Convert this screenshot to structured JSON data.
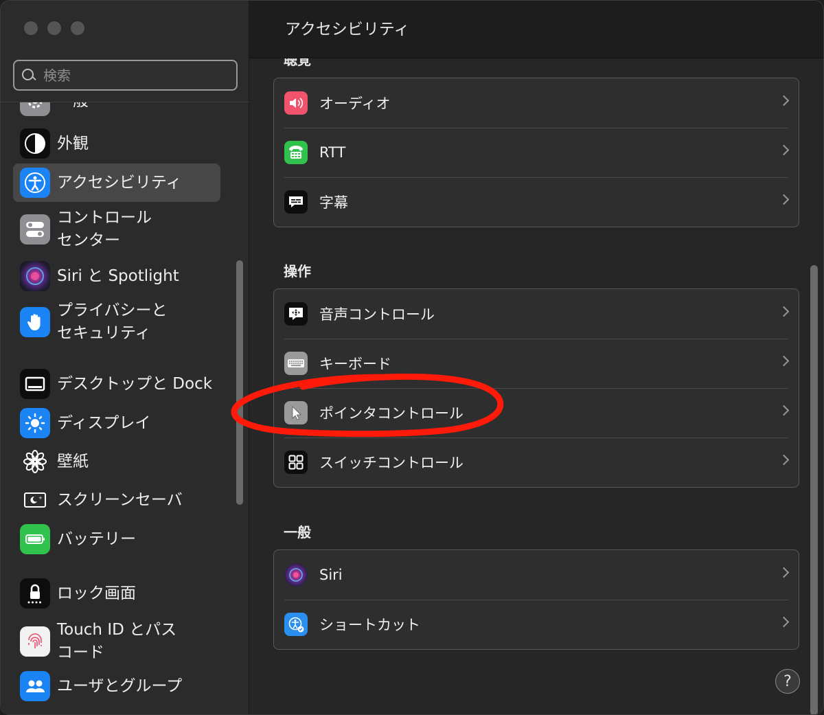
{
  "window": {
    "title": "アクセシビリティ"
  },
  "search": {
    "placeholder": "検索"
  },
  "sidebar": {
    "items": [
      {
        "label": "一般",
        "icon": "gear-icon"
      },
      {
        "label": "外観",
        "icon": "appearance-icon"
      },
      {
        "label": "アクセシビリティ",
        "icon": "accessibility-icon",
        "selected": true
      },
      {
        "label": "コントロール\nセンター",
        "icon": "control-center-icon"
      },
      {
        "label": "Siri と Spotlight",
        "icon": "siri-icon"
      },
      {
        "label": "プライバシーと\nセキュリティ",
        "icon": "hand-icon"
      },
      {
        "label": "デスクトップと Dock",
        "icon": "dock-icon"
      },
      {
        "label": "ディスプレイ",
        "icon": "sun-icon"
      },
      {
        "label": "壁紙",
        "icon": "flower-icon"
      },
      {
        "label": "スクリーンセーバ",
        "icon": "screensaver-icon"
      },
      {
        "label": "バッテリー",
        "icon": "battery-icon"
      },
      {
        "label": "ロック画面",
        "icon": "lock-icon"
      },
      {
        "label": "Touch ID とパス\nコード",
        "icon": "fingerprint-icon"
      },
      {
        "label": "ユーザとグループ",
        "icon": "users-icon"
      }
    ]
  },
  "main": {
    "cut_heading": "聴覚",
    "groups": [
      {
        "heading": "",
        "rows": [
          {
            "label": "オーディオ",
            "icon": "speaker-icon"
          },
          {
            "label": "RTT",
            "icon": "rtt-icon"
          },
          {
            "label": "字幕",
            "icon": "caption-icon"
          }
        ]
      },
      {
        "heading": "操作",
        "rows": [
          {
            "label": "音声コントロール",
            "icon": "voice-control-icon"
          },
          {
            "label": "キーボード",
            "icon": "keyboard-icon"
          },
          {
            "label": "ポインタコントロール",
            "icon": "pointer-icon"
          },
          {
            "label": "スイッチコントロール",
            "icon": "switch-control-icon"
          }
        ]
      },
      {
        "heading": "一般",
        "rows": [
          {
            "label": "Siri",
            "icon": "siri-icon"
          },
          {
            "label": "ショートカット",
            "icon": "shortcut-icon"
          }
        ]
      }
    ]
  },
  "help": {
    "label": "?"
  },
  "annotation": {
    "color": "#ff1a0a",
    "target": "ポインタコントロール"
  }
}
